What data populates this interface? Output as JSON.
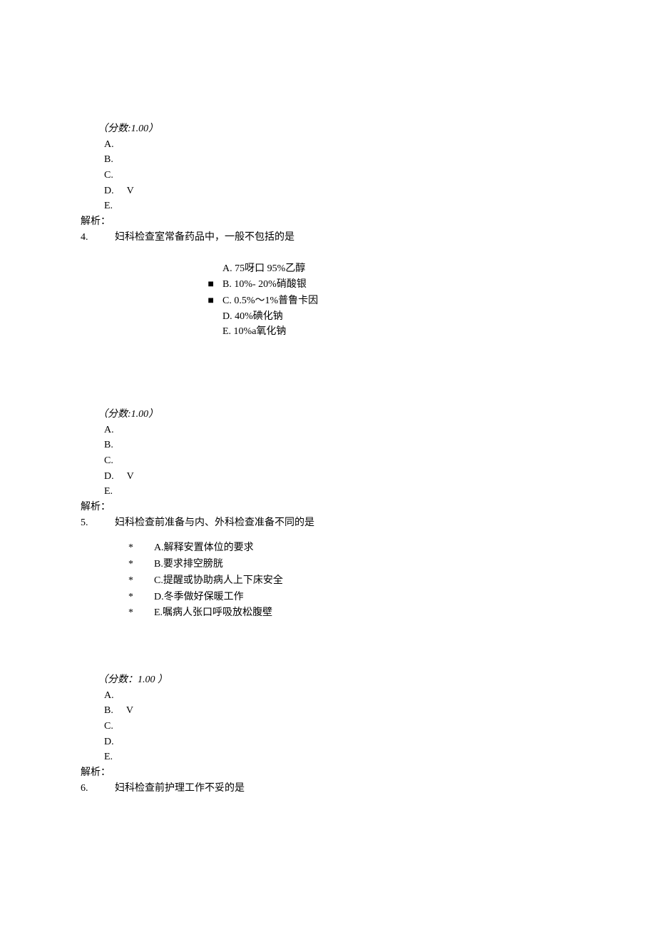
{
  "labels": {
    "score_prefix": "（分数:",
    "score_prefix_spaced": "（分数：",
    "score_suffix": "）",
    "score_suffix_spaced": " ）",
    "analysis": "解析：",
    "check": "V"
  },
  "markers": {
    "square": "■",
    "star": "*"
  },
  "q3": {
    "score": "1.00",
    "opts": {
      "A": "A.",
      "B": "B.",
      "C": "C.",
      "D": "D.",
      "E": "E."
    },
    "correct": "D"
  },
  "q4": {
    "number": "4.",
    "stem": "妇科检查室常备药品中，一般不包括的是",
    "options": {
      "A": "A.  75呀口  95%乙醇",
      "B": "B.  10%- 20%硝酸银",
      "C": "C.  0.5%～1%普鲁卡因",
      "D": "D.  40%碘化钠",
      "E": "E.  10%a氧化钠"
    },
    "opt_markers": {
      "A": "",
      "B": "■",
      "C": "■",
      "D": "",
      "E": ""
    },
    "score": "1.00",
    "opts": {
      "A": "A.",
      "B": "B.",
      "C": "C.",
      "D": "D.",
      "E": "E."
    },
    "correct": "D"
  },
  "q5": {
    "number": "5.",
    "stem": "妇科检查前准备与内、外科检查准备不同的是",
    "options": {
      "A": "A.解释安置体位的要求",
      "B": "B.要求排空膀胱",
      "C": "C.提醒或协助病人上下床安全",
      "D": "D.冬季做好保暖工作",
      "E": "E.嘱病人张口呼吸放松腹壁"
    },
    "score": "1.00",
    "opts": {
      "A": "A.",
      "B": "B.",
      "C": "C.",
      "D": "D.",
      "E": "E."
    },
    "correct": "B"
  },
  "q6": {
    "number": "6.",
    "stem": "妇科检查前护理工作不妥的是"
  }
}
